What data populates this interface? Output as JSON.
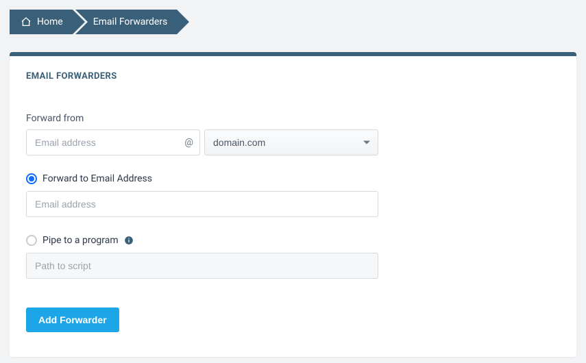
{
  "breadcrumb": {
    "home": "Home",
    "current": "Email Forwarders"
  },
  "panel": {
    "title": "EMAIL FORWARDERS"
  },
  "form": {
    "forward_from_label": "Forward from",
    "email_placeholder": "Email address",
    "at_symbol": "@",
    "domain_selected": "domain.com",
    "option_forward_label": "Forward to Email Address",
    "forward_to_placeholder": "Email address",
    "option_pipe_label": "Pipe to a program",
    "pipe_placeholder": "Path to script",
    "submit_label": "Add Forwarder"
  }
}
